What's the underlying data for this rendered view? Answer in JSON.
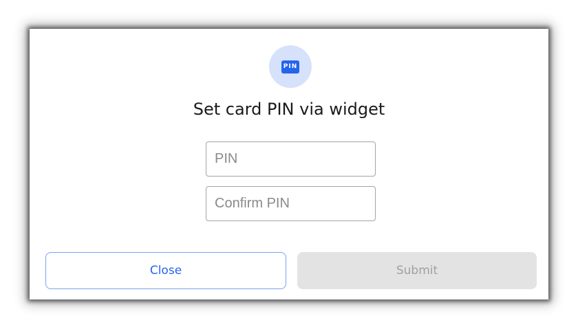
{
  "dialog": {
    "badge": {
      "icon": "pin-icon",
      "text": "PIN"
    },
    "title": "Set card PIN via widget",
    "fields": {
      "pin": {
        "placeholder": "PIN",
        "value": ""
      },
      "confirm_pin": {
        "placeholder": "Confirm PIN",
        "value": ""
      }
    },
    "buttons": {
      "close_label": "Close",
      "submit_label": "Submit",
      "submit_disabled": true
    }
  },
  "colors": {
    "accent": "#2563eb",
    "badge_background": "#d6e1fb",
    "close_border": "#7aa2f0",
    "submit_disabled_background": "#e3e3e3",
    "submit_disabled_text": "#a0a0a0"
  }
}
